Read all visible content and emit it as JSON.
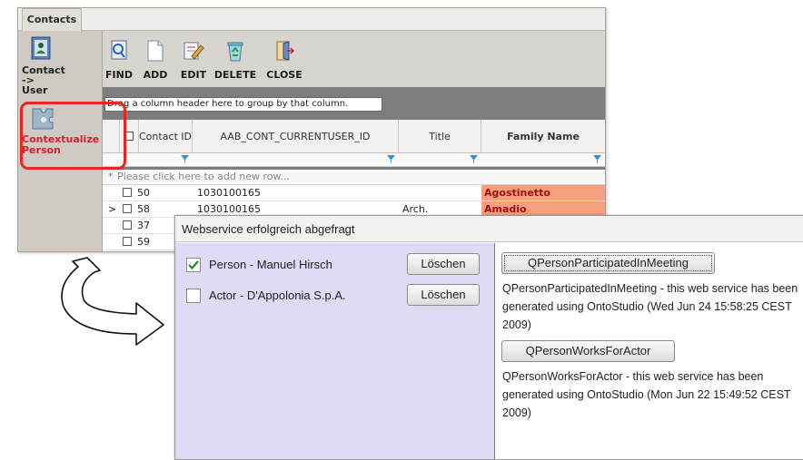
{
  "app": {
    "tab_label": "Contacts",
    "nav": [
      {
        "label": "Contact\n->\nUser",
        "icon": "contact-user-icon"
      },
      {
        "label": "Contextualize\nPerson",
        "icon": "puzzle-icon"
      }
    ],
    "toolbar": {
      "find": "FIND",
      "add": "ADD",
      "edit": "EDIT",
      "delete": "DELETE",
      "close": "CLOSE"
    },
    "grid": {
      "group_hint": "Drag a column header here to group by that column.",
      "columns": [
        "Contact ID",
        "AAB_CONT_CURRENTUSER_ID",
        "Title",
        "Family Name"
      ],
      "new_row_text": "Please click here to add new row...",
      "rows": [
        {
          "id": "50",
          "user_id": "1030100165",
          "title": "",
          "family": "Agostinetto"
        },
        {
          "id": "58",
          "user_id": "1030100165",
          "title": "Arch.",
          "family": "Amadio"
        },
        {
          "id": "37",
          "user_id": "",
          "title": "",
          "family": ""
        },
        {
          "id": "59",
          "user_id": "",
          "title": "",
          "family": ""
        }
      ],
      "new_row_marker": "*",
      "current_row_marker": ">"
    },
    "colors": {
      "highlight": "#e5271f",
      "family_cell": "#f59f7e"
    }
  },
  "dialog": {
    "title": "Webservice erfolgreich abgefragt",
    "items": [
      {
        "label": "Person - Manuel Hirsch",
        "checked": true,
        "button": "Löschen"
      },
      {
        "label": "Actor - D'Appolonia S.p.A.",
        "checked": false,
        "button": "Löschen"
      }
    ],
    "services": [
      {
        "button": "QPersonParticipatedInMeeting",
        "description": "QPersonParticipatedInMeeting - this web service has been generated using OntoStudio (Wed Jun 24 15:58:25 CEST 2009)"
      },
      {
        "button": "QPersonWorksForActor",
        "description": "QPersonWorksForActor - this web service has been generated using OntoStudio (Mon Jun 22 15:49:52 CEST 2009)"
      }
    ]
  }
}
